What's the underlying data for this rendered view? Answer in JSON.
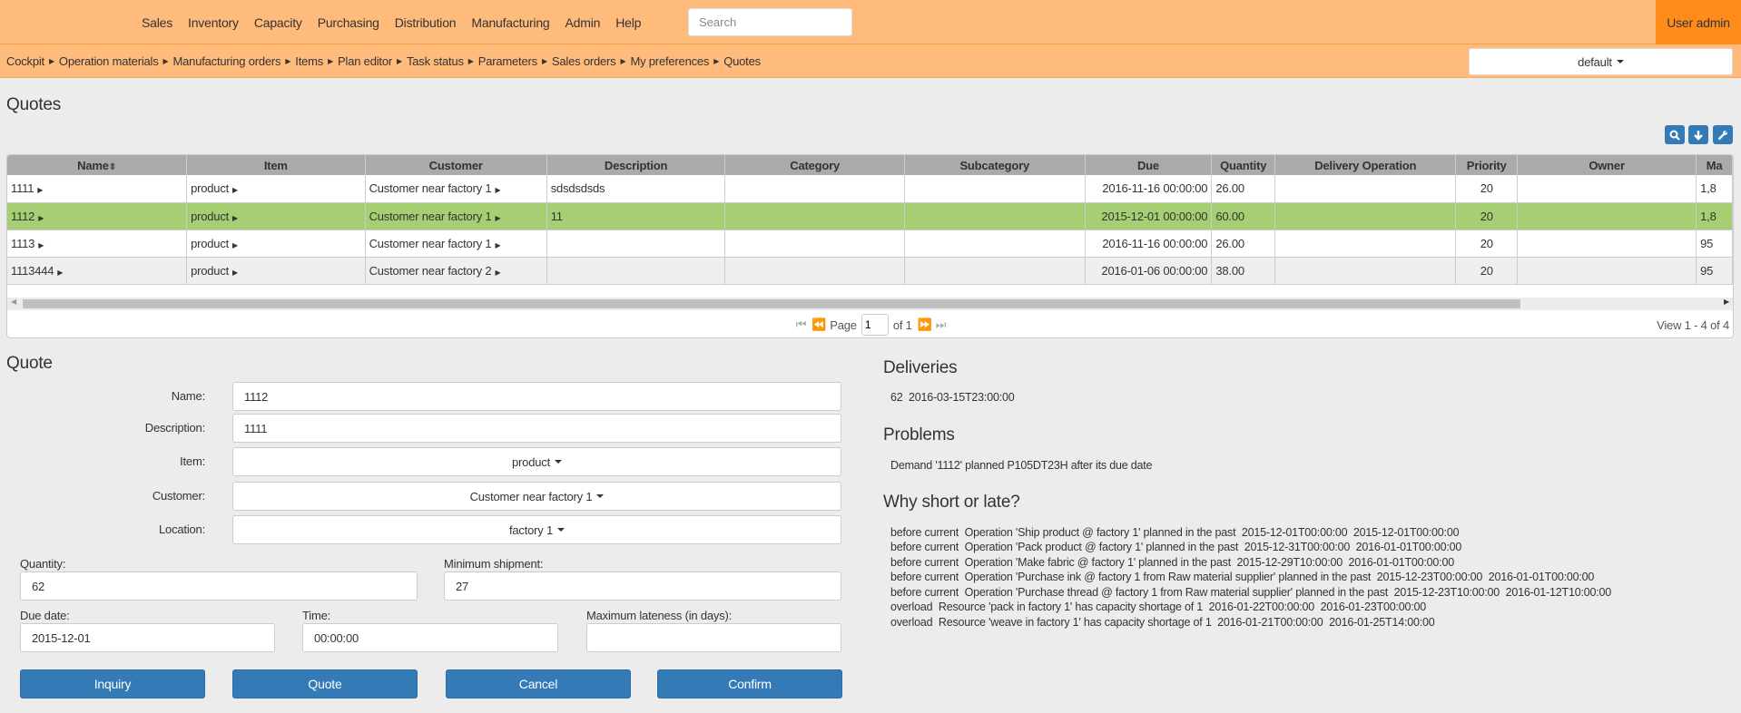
{
  "nav": {
    "menu": [
      "Sales",
      "Inventory",
      "Capacity",
      "Purchasing",
      "Distribution",
      "Manufacturing",
      "Admin",
      "Help"
    ],
    "search_placeholder": "Search",
    "user": "User admin"
  },
  "breadcrumbs": [
    "Cockpit",
    "Operation materials",
    "Manufacturing orders",
    "Items",
    "Plan editor",
    "Task status",
    "Parameters",
    "Sales orders",
    "My preferences",
    "Quotes"
  ],
  "preference_select": "default",
  "page_title": "Quotes",
  "toolbar_icons": [
    "search-icon",
    "download-icon",
    "wrench-icon"
  ],
  "grid": {
    "columns": [
      "Name",
      "Item",
      "Customer",
      "Description",
      "Category",
      "Subcategory",
      "Due",
      "Quantity",
      "Delivery Operation",
      "Priority",
      "Owner",
      "Ma"
    ],
    "rows": [
      {
        "name": "1111",
        "item": "product",
        "customer": "Customer near factory 1",
        "description": "sdsdsdsds",
        "category": "",
        "subcategory": "",
        "due": "2016-11-16 00:00:00",
        "quantity": "26.00",
        "delivery_operation": "",
        "priority": "20",
        "owner": "",
        "extra": "1,8"
      },
      {
        "name": "1112",
        "item": "product",
        "customer": "Customer near factory 1",
        "description": "11",
        "category": "",
        "subcategory": "",
        "due": "2015-12-01 00:00:00",
        "quantity": "60.00",
        "delivery_operation": "",
        "priority": "20",
        "owner": "",
        "extra": "1,8",
        "selected": true
      },
      {
        "name": "1113",
        "item": "product",
        "customer": "Customer near factory 1",
        "description": "",
        "category": "",
        "subcategory": "",
        "due": "2016-11-16 00:00:00",
        "quantity": "26.00",
        "delivery_operation": "",
        "priority": "20",
        "owner": "",
        "extra": "95"
      },
      {
        "name": "1113444",
        "item": "product",
        "customer": "Customer near factory 2",
        "description": "",
        "category": "",
        "subcategory": "",
        "due": "2016-01-06 00:00:00",
        "quantity": "38.00",
        "delivery_operation": "",
        "priority": "20",
        "owner": "",
        "extra": "95"
      }
    ],
    "pager": {
      "page_label": "Page",
      "page": "1",
      "of_label": "of 1",
      "view": "View 1 - 4 of 4"
    },
    "selected_row_color": "#a5cf72"
  },
  "quote": {
    "title": "Quote",
    "name_label": "Name:",
    "name": "1112",
    "description_label": "Description:",
    "description": "1111",
    "item_label": "Item:",
    "item": "product",
    "customer_label": "Customer:",
    "customer": "Customer near factory 1",
    "location_label": "Location:",
    "location": "factory 1",
    "quantity_label": "Quantity:",
    "quantity": "62",
    "min_shipment_label": "Minimum shipment:",
    "min_shipment": "27",
    "due_date_label": "Due date:",
    "due_date": "2015-12-01",
    "time_label": "Time:",
    "time": "00:00:00",
    "max_lateness_label": "Maximum lateness (in days):",
    "max_lateness": "",
    "buttons": [
      "Inquiry",
      "Quote",
      "Cancel",
      "Confirm"
    ]
  },
  "deliveries": {
    "title": "Deliveries",
    "items": [
      "62  2016-03-15T23:00:00"
    ]
  },
  "problems": {
    "title": "Problems",
    "items": [
      "Demand '1112' planned P105DT23H after its due date"
    ]
  },
  "why": {
    "title": "Why short or late?",
    "items": [
      "before current  Operation 'Ship product @ factory 1' planned in the past  2015-12-01T00:00:00  2015-12-01T00:00:00",
      "before current  Operation 'Pack product @ factory 1' planned in the past  2015-12-31T00:00:00  2016-01-01T00:00:00",
      "before current  Operation 'Make fabric @ factory 1' planned in the past  2015-12-29T10:00:00  2016-01-01T00:00:00",
      "before current  Operation 'Purchase ink @ factory 1 from Raw material supplier' planned in the past  2015-12-23T00:00:00  2016-01-01T00:00:00",
      "before current  Operation 'Purchase thread @ factory 1 from Raw material supplier' planned in the past  2015-12-23T10:00:00  2016-01-12T10:00:00",
      "overload  Resource 'pack in factory 1' has capacity shortage of 1  2016-01-22T00:00:00  2016-01-23T00:00:00",
      "overload  Resource 'weave in factory 1' has capacity shortage of 1  2016-01-21T00:00:00  2016-01-25T14:00:00"
    ]
  }
}
